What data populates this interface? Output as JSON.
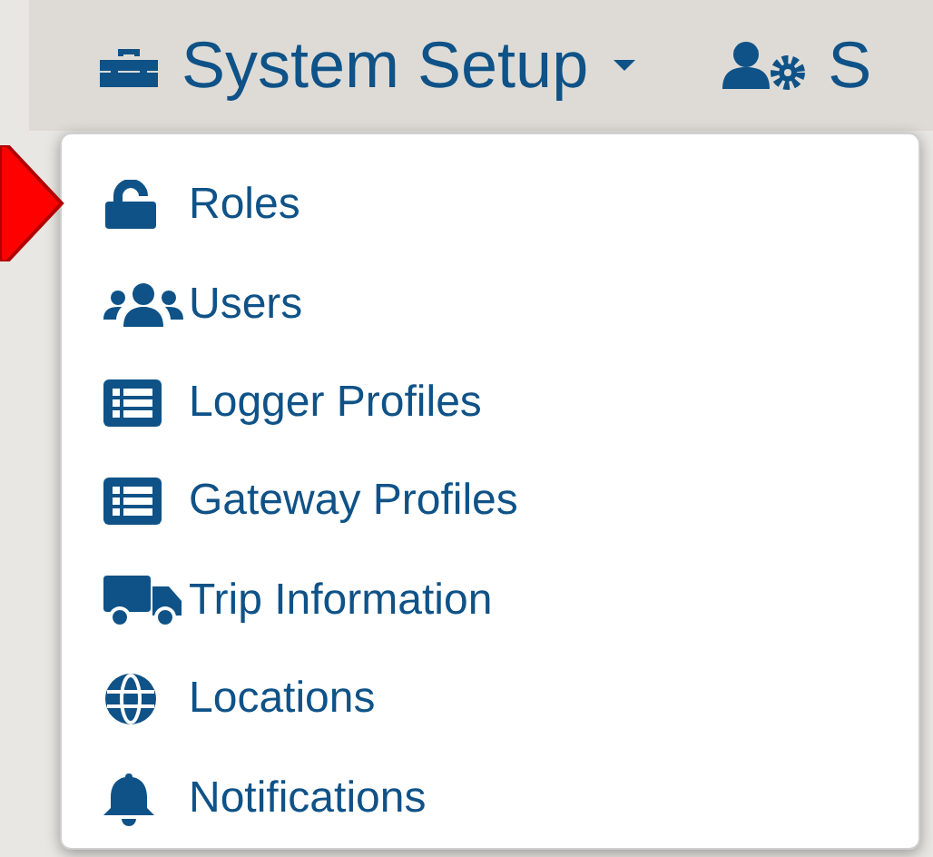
{
  "navbar": {
    "items": [
      {
        "label": "System Setup",
        "kind": "toolbox",
        "expanded": true
      },
      {
        "label": "S",
        "kind": "user-gear",
        "expanded": false
      }
    ]
  },
  "dropdown": {
    "items": [
      {
        "label": "Roles",
        "kind": "lock",
        "selected": true
      },
      {
        "label": "Users",
        "kind": "users",
        "selected": false
      },
      {
        "label": "Logger Profiles",
        "kind": "list",
        "selected": false
      },
      {
        "label": "Gateway Profiles",
        "kind": "list",
        "selected": false
      },
      {
        "label": "Trip Information",
        "kind": "truck",
        "selected": false
      },
      {
        "label": "Locations",
        "kind": "globe",
        "selected": false
      },
      {
        "label": "Notifications",
        "kind": "bell",
        "selected": false
      }
    ]
  }
}
